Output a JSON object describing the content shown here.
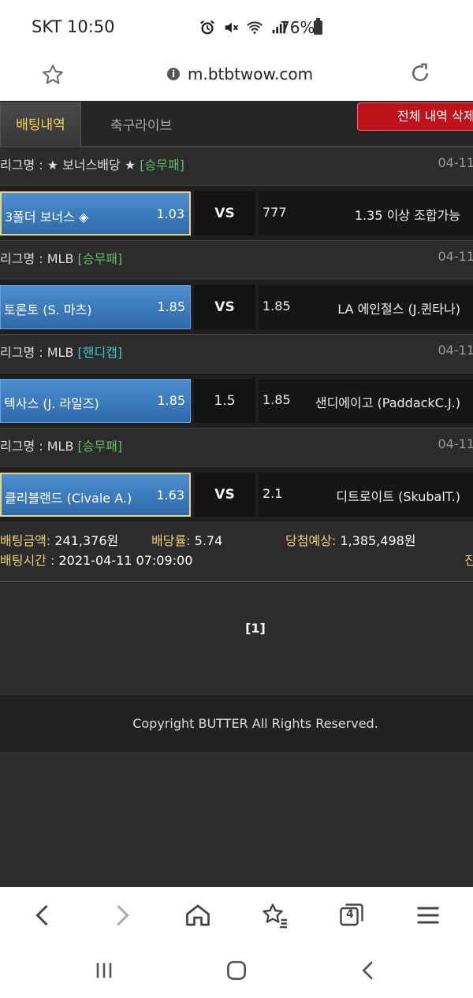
{
  "status_bar": {
    "carrier_time": "SKT 10:50",
    "battery": "76%"
  },
  "browser": {
    "url": "m.btbtwow.com",
    "tabs_count": "4"
  },
  "tabs": {
    "active": "배팅내역",
    "other": "축구라이브",
    "delete_button": "전체 내역 삭제"
  },
  "bets": [
    {
      "league": "리그명 : ★ 보너스배당 ★",
      "market": "[승무패]",
      "date": "04-11",
      "home_team": "3폴더 보너스 ◈",
      "home_odds": "1.03",
      "middle": "VS",
      "away_odds": "777",
      "away_team": "1.35 이상 조합가능"
    },
    {
      "league": "리그명 : MLB",
      "market": "[승무패]",
      "date": "04-11",
      "home_team": "토론토 (S. 마츠)",
      "home_odds": "1.85",
      "middle": "VS",
      "away_odds": "1.85",
      "away_team": "LA 에인절스 (J.퀸타나)"
    },
    {
      "league": "리그명 : MLB",
      "market": "[핸디캡]",
      "date": "04-11",
      "home_team": "텍사스 (J. 라일즈)",
      "home_odds": "1.85",
      "middle": "1.5",
      "away_odds": "1.85",
      "away_team": "샌디에이고 (PaddackC.J.)"
    },
    {
      "league": "리그명 : MLB",
      "market": "[승무패]",
      "date": "04-11",
      "home_team": "클리블랜드 (Civale A.)",
      "home_odds": "1.63",
      "middle": "VS",
      "away_odds": "2.1",
      "away_team": "디트로이트 (SkubalT.)"
    }
  ],
  "summary": {
    "amount_label": "배팅금액:",
    "amount_value": "241,376원",
    "rate_label": "배당률:",
    "rate_value": "5.74",
    "win_label": "당첨예상:",
    "win_value": "1,385,498원",
    "time_label": "배팅시간 :",
    "time_value": "2021-04-11 07:09:00",
    "edge_label": "진"
  },
  "pagination": "[1]",
  "footer": "Copyright BUTTER All Rights Reserved."
}
